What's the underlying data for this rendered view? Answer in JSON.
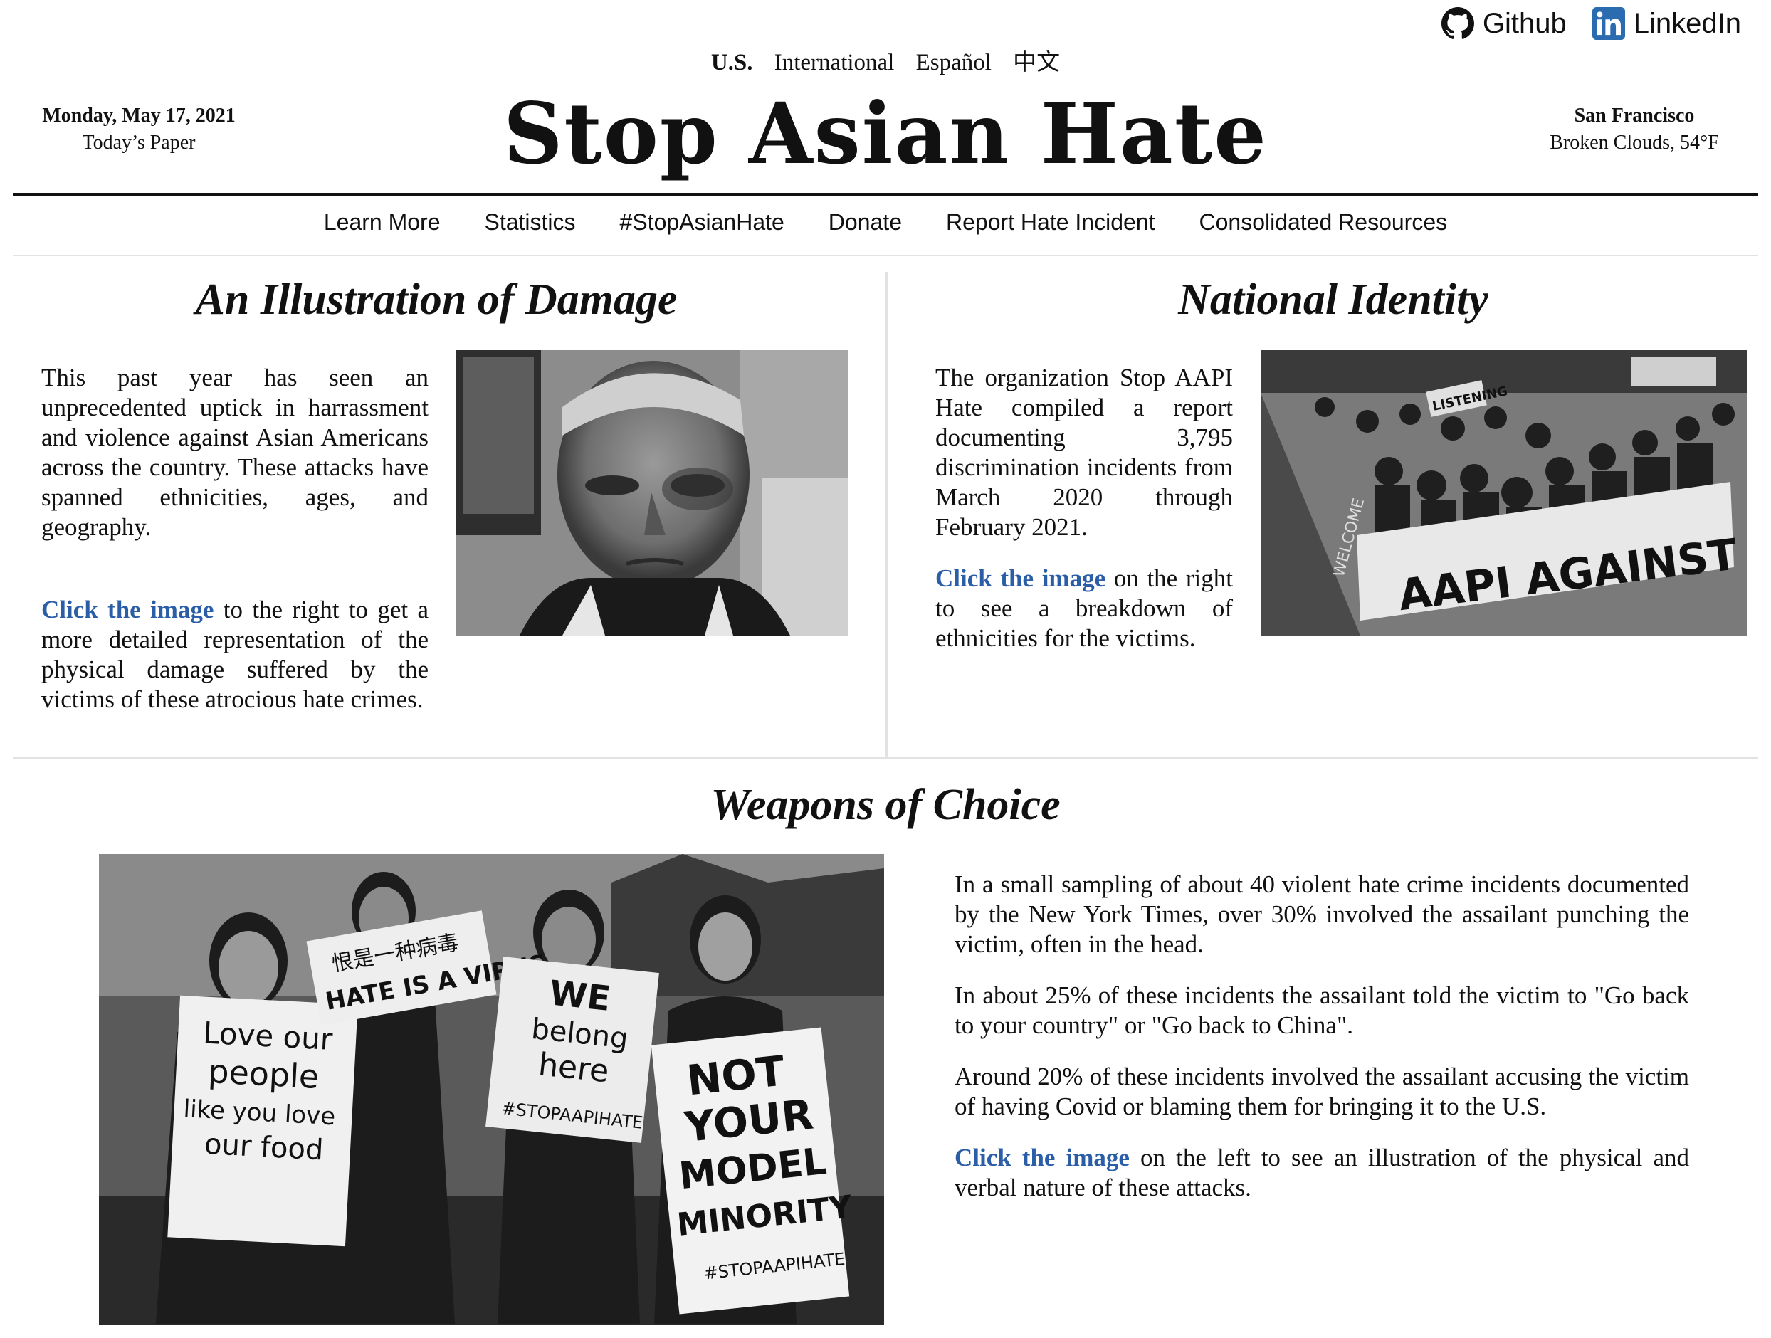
{
  "social": {
    "github_label": "Github",
    "linkedin_label": "LinkedIn"
  },
  "editions": [
    "U.S.",
    "International",
    "Español",
    "中文"
  ],
  "date": {
    "day": "Monday, May 17, 2021",
    "paper": "Today’s Paper"
  },
  "weather": {
    "city": "San Francisco",
    "conditions": "Broken Clouds, 54°F"
  },
  "masthead": "Stop Asian Hate",
  "nav": [
    "Learn More",
    "Statistics",
    "#StopAsianHate",
    "Donate",
    "Report Hate Incident",
    "Consolidated Resources"
  ],
  "sections": {
    "damage": {
      "headline": "An Illustration of Damage",
      "paragraph": "This past year has seen an unprecedented uptick in harrassment and violence against Asian Americans across the country. These attacks have spanned ethnicities, ages, and geography.",
      "link": "Click the image",
      "after_link": " to the right to get a more detailed representation of the physical damage suffered by the victims of these atrocious hate crimes."
    },
    "identity": {
      "headline": "National Identity",
      "paragraph": "The organization Stop AAPI Hate compiled a report documenting 3,795 discrimination incidents from March 2020 through February 2021.",
      "link": "Click the image",
      "after_link": " on the right to see a breakdown of ethnicities for the victims.",
      "banner_text": "AAPI AGAINST HATE",
      "sign_text": "LISTENING",
      "street_text": "WELCOME"
    },
    "weapons": {
      "headline": "Weapons of Choice",
      "p1": "In a small sampling of about 40 violent hate crime incidents documented by the New York Times, over 30% involved the assailant punching the victim, often in the head.",
      "p2": "In about 25% of these incidents the assailant told the victim to \"Go back to your country\" or \"Go back to China\".",
      "p3": "Around 20% of these incidents involved the assailant accusing the victim of having Covid or blaming them for bringing it to the U.S.",
      "link": "Click the image",
      "after_link": " on the left to see an illustration of the physical and verbal nature of these attacks.",
      "signs": {
        "s1_l1": "Love our",
        "s1_l2": "people",
        "s1_l3": "like you love",
        "s1_l4": "our food",
        "s2_l1": "恨是一种病毒",
        "s2_l2": "HATE IS A VIRUS",
        "s3_l1": "WE",
        "s3_l2": "belong",
        "s3_l3": "here",
        "s3_l4": "#STOPAAPIHATE",
        "s4_l1": "NOT",
        "s4_l2": "YOUR",
        "s4_l3": "MODEL",
        "s4_l4": "MINORITY",
        "s4_l5": "#STOPAAPIHATE"
      }
    }
  },
  "colors": {
    "link": "#2b5ea7",
    "rule": "#111111",
    "divider": "#e2e2e2"
  }
}
